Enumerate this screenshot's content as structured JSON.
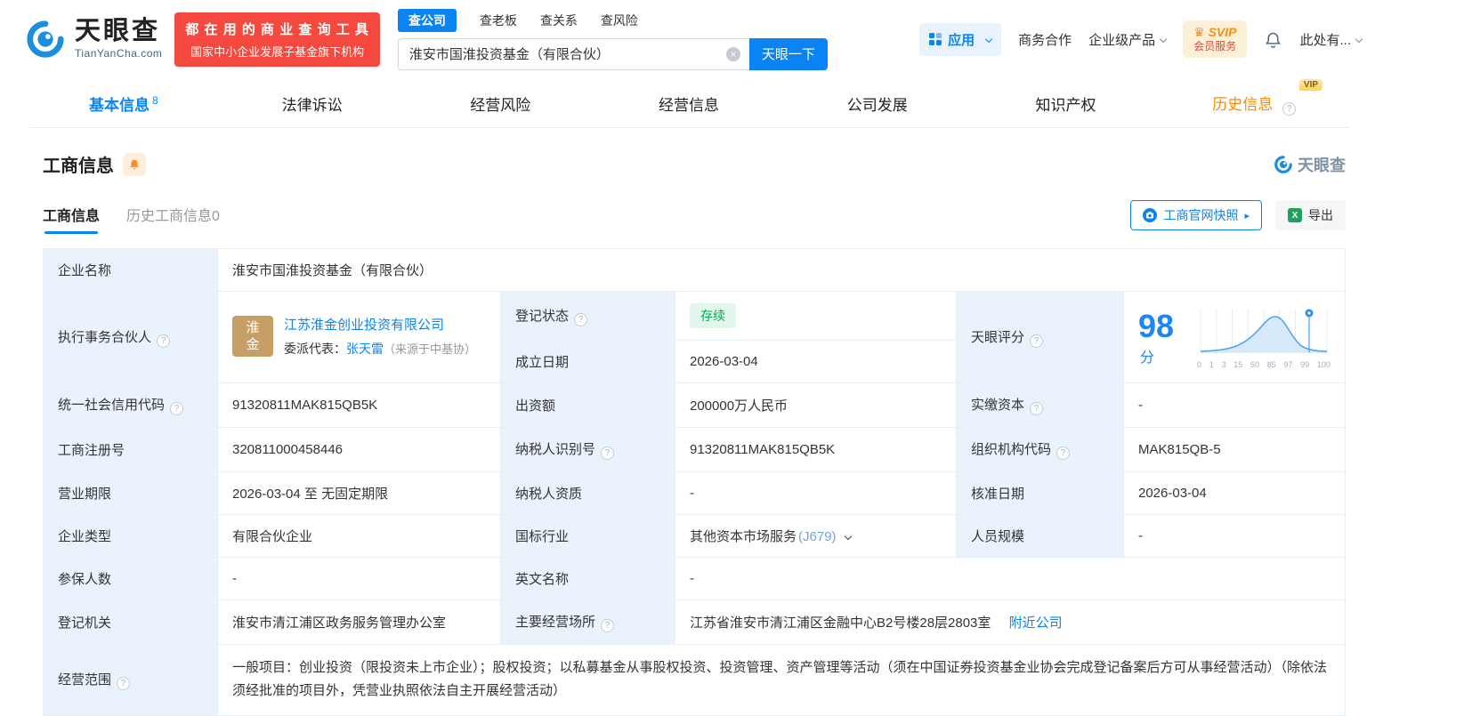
{
  "header": {
    "logo": {
      "brand": "天眼查",
      "domain": "TianYanCha.com"
    },
    "promo": {
      "line1": "都 在 用 的 商 业 查 询 工 具",
      "line2": "国家中小企业发展子基金旗下机构"
    },
    "search": {
      "tabs": [
        {
          "label": "查公司"
        },
        {
          "label": "查老板"
        },
        {
          "label": "查关系"
        },
        {
          "label": "查风险"
        }
      ],
      "value": "淮安市国淮投资基金（有限合伙）",
      "button": "天眼一下"
    },
    "right": {
      "apps": "应用",
      "cooperation": "商务合作",
      "enterprise": "企业级产品",
      "svip_title": "SVIP",
      "svip_subtitle": "会员服务",
      "account": "此处有..."
    }
  },
  "nav": {
    "tabs": [
      {
        "label": "基本信息",
        "count": "8"
      },
      {
        "label": "法律诉讼"
      },
      {
        "label": "经营风险"
      },
      {
        "label": "经营信息"
      },
      {
        "label": "公司发展"
      },
      {
        "label": "知识产权"
      },
      {
        "label": "历史信息",
        "vip": "VIP"
      }
    ]
  },
  "section": {
    "title": "工商信息",
    "watermark": "天眼查",
    "subtabs": [
      {
        "label": "工商信息"
      },
      {
        "label": "历史工商信息0"
      }
    ],
    "snapshot_button": "工商官网快照",
    "export_button": "导出"
  },
  "table": {
    "company_name": {
      "label": "企业名称",
      "value": "淮安市国淮投资基金（有限合伙）"
    },
    "partner": {
      "label": "执行事务合伙人",
      "badge": "淮金",
      "company": "江苏淮金创业投资有限公司",
      "rep_label": "委派代表：",
      "rep_name": "张天雷",
      "rep_source": "（来源于中基协）"
    },
    "reg_status": {
      "label": "登记状态",
      "value": "存续"
    },
    "establish_date": {
      "label": "成立日期",
      "value": "2026-03-04"
    },
    "score": {
      "label": "天眼评分"
    },
    "credit_code": {
      "label": "统一社会信用代码",
      "value": "91320811MAK815QB5K"
    },
    "capital": {
      "label": "出资额",
      "value": "200000万人民币"
    },
    "paid_capital": {
      "label": "实缴资本",
      "value": "-"
    },
    "reg_number": {
      "label": "工商注册号",
      "value": "320811000458446"
    },
    "taxpayer_id": {
      "label": "纳税人识别号",
      "value": "91320811MAK815QB5K"
    },
    "org_code": {
      "label": "组织机构代码",
      "value": "MAK815QB-5"
    },
    "business_term": {
      "label": "营业期限",
      "value": "2026-03-04 至 无固定期限"
    },
    "taxpayer_quality": {
      "label": "纳税人资质",
      "value": "-"
    },
    "approval_date": {
      "label": "核准日期",
      "value": "2026-03-04"
    },
    "company_type": {
      "label": "企业类型",
      "value": "有限合伙企业"
    },
    "industry": {
      "label": "国标行业",
      "value": "其他资本市场服务",
      "code": "(J679)"
    },
    "staff_size": {
      "label": "人员规模",
      "value": "-"
    },
    "insured_count": {
      "label": "参保人数",
      "value": "-"
    },
    "english_name": {
      "label": "英文名称",
      "value": "-"
    },
    "reg_authority": {
      "label": "登记机关",
      "value": "淮安市清江浦区政务服务管理办公室"
    },
    "business_address": {
      "label": "主要经营场所",
      "value": "江苏省淮安市清江浦区金融中心B2号楼28层2803室",
      "nearby_link": "附近公司"
    },
    "business_scope": {
      "label": "经营范围",
      "value": "一般项目：创业投资（限投资未上市企业）；股权投资；以私募基金从事股权投资、投资管理、资产管理等活动（须在中国证券投资基金业协会完成登记备案后方可从事经营活动）（除依法须经批准的项目外，凭营业执照依法自主开展经营活动）"
    }
  },
  "score_chart": {
    "score": "98",
    "unit": "分",
    "axis_labels": [
      "0",
      "1",
      "3",
      "15",
      "50",
      "85",
      "97",
      "99",
      "100"
    ]
  }
}
